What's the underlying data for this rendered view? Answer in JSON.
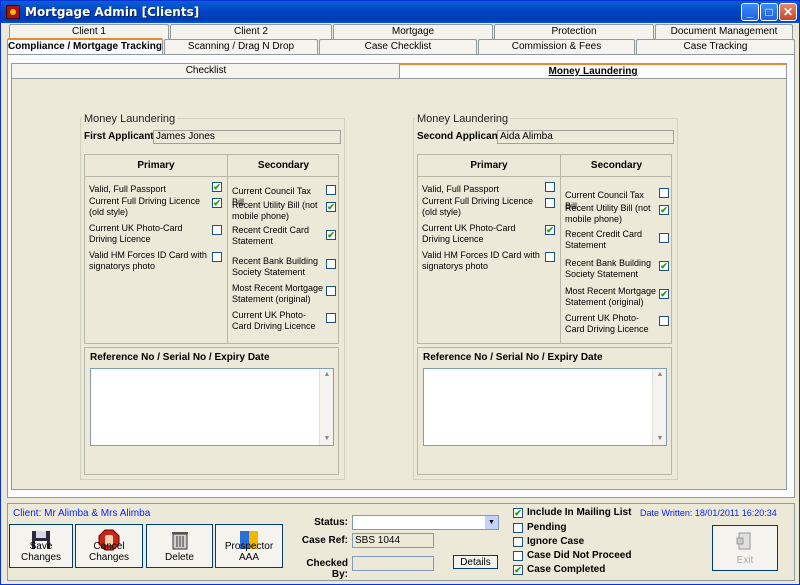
{
  "window": {
    "title": "Mortgage Admin [Clients]"
  },
  "tabs_row1": [
    "Client 1",
    "Client 2",
    "Mortgage",
    "Protection",
    "Document Management"
  ],
  "tabs_row2": [
    "Compliance / Mortgage Tracking",
    "Scanning / Drag N Drop",
    "Case Checklist",
    "Commission & Fees",
    "Case Tracking"
  ],
  "inner_tabs": [
    "Checklist",
    "Money Laundering"
  ],
  "first": {
    "legend": "Money Laundering",
    "applicant_label": "First Applicant",
    "applicant_name": "James Jones",
    "primary_header": "Primary",
    "secondary_header": "Secondary",
    "primary": [
      {
        "label": "Valid, Full Passport",
        "checked": true
      },
      {
        "label": "Current Full Driving Licence (old style)",
        "checked": true
      },
      {
        "label": "Current UK Photo-Card Driving Licence",
        "checked": false
      },
      {
        "label": "Valid HM Forces ID Card with signatorys photo",
        "checked": false
      }
    ],
    "secondary": [
      {
        "label": "Current Council Tax Bill",
        "checked": false
      },
      {
        "label": "Recent Utility Bill (not mobile phone)",
        "checked": true
      },
      {
        "label": "Recent Credit Card Statement",
        "checked": true
      },
      {
        "label": "Recent Bank Building Society Statement",
        "checked": false
      },
      {
        "label": "Most Recent Mortgage Statement (original)",
        "checked": false
      },
      {
        "label": "Current UK Photo-Card Driving Licence",
        "checked": false
      }
    ],
    "ref_label": "Reference No / Serial No / Expiry Date"
  },
  "second": {
    "legend": "Money Laundering",
    "applicant_label": "Second Applicant",
    "applicant_name": "Aida Alimba",
    "primary_header": "Primary",
    "secondary_header": "Secondary",
    "primary": [
      {
        "label": "Valid, Full Passport",
        "checked": false
      },
      {
        "label": "Current Full Driving Licence (old style)",
        "checked": false
      },
      {
        "label": "Current UK Photo-Card Driving Licence",
        "checked": true
      },
      {
        "label": "Valid HM Forces ID Card with signatorys photo",
        "checked": false
      }
    ],
    "secondary": [
      {
        "label": "Current Council Tax Bill",
        "checked": false
      },
      {
        "label": "Recent Utility Bill (not mobile phone)",
        "checked": true
      },
      {
        "label": "Recent Credit Card Statement",
        "checked": false
      },
      {
        "label": "Recent Bank Building Society Statement",
        "checked": true
      },
      {
        "label": "Most Recent Mortgage Statement (original)",
        "checked": true
      },
      {
        "label": "Current UK Photo-Card Driving Licence",
        "checked": false
      }
    ],
    "ref_label": "Reference No / Serial No / Expiry Date"
  },
  "footer": {
    "client": "Client: Mr Alimba & Mrs Alimba",
    "date_written": "Date Written: 18/01/2011 16:20:34",
    "buttons": [
      "Save Changes",
      "Cancel Changes",
      "Delete",
      "Prospector AAA"
    ],
    "status_label": "Status:",
    "status_value": "",
    "case_ref_label": "Case Ref:",
    "case_ref_value": "SBS 1044",
    "checked_by_label": "Checked By:",
    "checked_by_value": "",
    "details_label": "Details",
    "exit_label": "Exit",
    "options": [
      {
        "label": "Include In Mailing List",
        "checked": true
      },
      {
        "label": "Pending",
        "checked": false
      },
      {
        "label": "Ignore Case",
        "checked": false
      },
      {
        "label": "Case Did Not Proceed",
        "checked": false
      },
      {
        "label": "Case Completed",
        "checked": true
      }
    ]
  }
}
